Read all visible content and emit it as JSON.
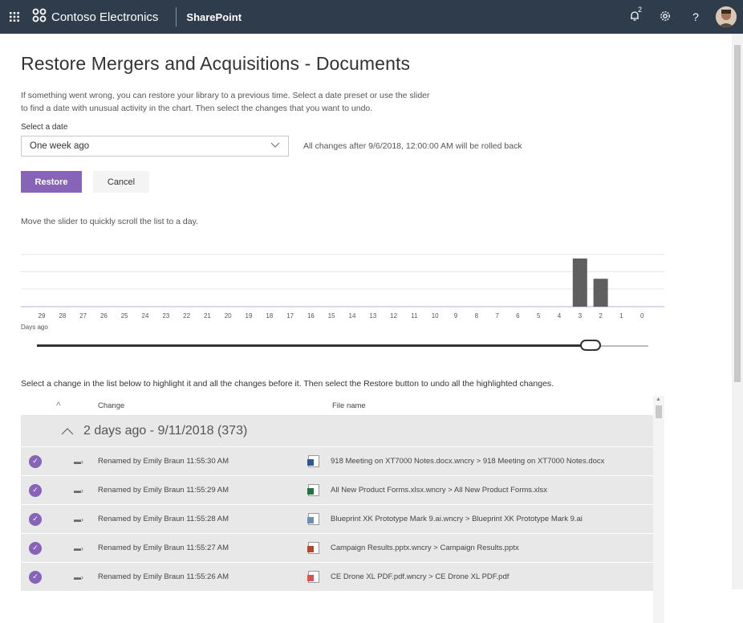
{
  "suitebar": {
    "org_name": "Contoso Electronics",
    "app_name": "SharePoint",
    "notification_count": "2",
    "help_label": "?"
  },
  "page": {
    "title": "Restore Mergers and Acquisitions - Documents",
    "description": "If something went wrong, you can restore your library to a previous time. Select a date preset or use the slider to find a date with unusual activity in the chart. Then select the changes that you want to undo.",
    "date_label": "Select a date",
    "date_value": "One week ago",
    "date_note": "All changes after 9/6/2018, 12:00:00 AM will be rolled back",
    "restore_label": "Restore",
    "cancel_label": "Cancel",
    "slider_hint": "Move the slider to quickly scroll the list to a day.",
    "days_ago_label": "Days ago",
    "select_hint": "Select a change in the list below to highlight it and all the changes before it. Then select the Restore button to undo all the highlighted changes."
  },
  "chart_data": {
    "type": "bar",
    "categories": [
      "29",
      "28",
      "27",
      "26",
      "25",
      "24",
      "23",
      "22",
      "21",
      "20",
      "19",
      "18",
      "17",
      "16",
      "15",
      "14",
      "13",
      "12",
      "11",
      "10",
      "9",
      "8",
      "7",
      "6",
      "5",
      "4",
      "3",
      "2",
      "1",
      "0"
    ],
    "values": [
      0,
      0,
      0,
      0,
      0,
      0,
      0,
      0,
      0,
      0,
      0,
      0,
      0,
      0,
      0,
      0,
      0,
      0,
      0,
      0,
      0,
      0,
      0,
      0,
      0,
      0,
      100,
      58,
      0,
      0
    ],
    "xlabel": "Days ago",
    "ylabel": "",
    "ylim": [
      0,
      100
    ],
    "colors": {
      "bar": "#5f5f5f",
      "grid": "#e6e6e6",
      "baseline": "#c7cbe8"
    }
  },
  "slider": {
    "value_fraction": 0.905
  },
  "list": {
    "header": {
      "change": "Change",
      "file_name": "File name"
    },
    "group": {
      "title": "2 days ago - 9/11/2018 (373)"
    },
    "rows": [
      {
        "change": "Renamed by Emily Braun 11:55:30 AM",
        "file": "918 Meeting on XT7000 Notes.docx.wncry > 918 Meeting on XT7000 Notes.docx",
        "icon": "word-file-icon",
        "color": "#2b579a"
      },
      {
        "change": "Renamed by Emily Braun 11:55:29 AM",
        "file": "All New Product Forms.xlsx.wncry > All New Product Forms.xlsx",
        "icon": "excel-file-icon",
        "color": "#217346"
      },
      {
        "change": "Renamed by Emily Braun 11:55:28 AM",
        "file": "Blueprint XK Prototype Mark 9.ai.wncry > Blueprint XK Prototype Mark 9.ai",
        "icon": "image-file-icon",
        "color": "#6c8fb5"
      },
      {
        "change": "Renamed by Emily Braun 11:55:27 AM",
        "file": "Campaign Results.pptx.wncry > Campaign Results.pptx",
        "icon": "powerpoint-file-icon",
        "color": "#b7472a"
      },
      {
        "change": "Renamed by Emily Braun 11:55:26 AM",
        "file": "CE Drone XL PDF.pdf.wncry > CE Drone XL PDF.pdf",
        "icon": "pdf-file-icon",
        "color": "#d9534f"
      }
    ]
  }
}
